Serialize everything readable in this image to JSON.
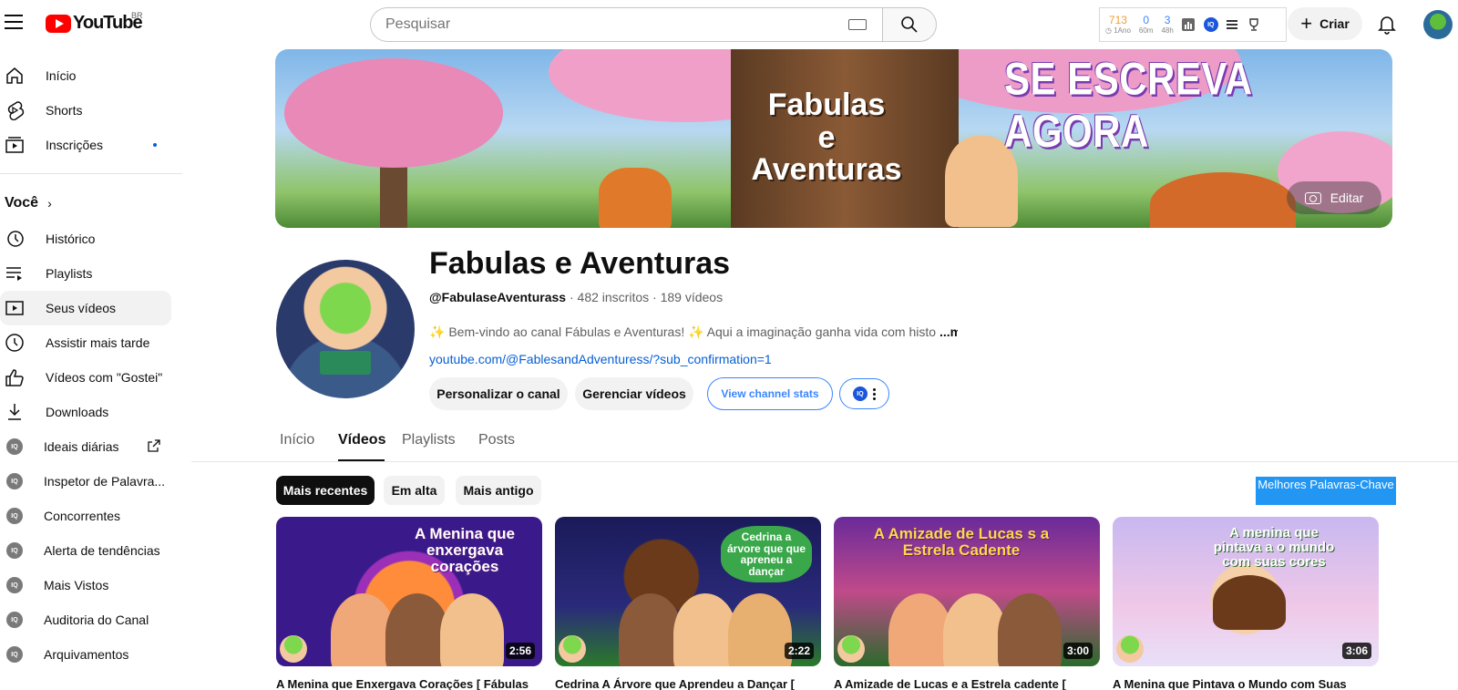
{
  "header": {
    "logo_text": "YouTube",
    "logo_country": "BR",
    "search_placeholder": "Pesquisar",
    "vidiq_stats": [
      {
        "value": "713",
        "label": "◷ 1Ano"
      },
      {
        "value": "0",
        "label": "60m"
      },
      {
        "value": "3",
        "label": "48h"
      }
    ],
    "create_label": "Criar",
    "colors": {
      "brand_red": "#ff0000",
      "vidiq_blue": "#3a86ff"
    }
  },
  "sidebar": {
    "main": [
      {
        "label": "Início",
        "icon": "home-icon"
      },
      {
        "label": "Shorts",
        "icon": "shorts-icon"
      },
      {
        "label": "Inscrições",
        "icon": "subscriptions-icon"
      }
    ],
    "you_label": "Você",
    "you_items": [
      {
        "label": "Histórico",
        "icon": "history-icon"
      },
      {
        "label": "Playlists",
        "icon": "playlists-icon"
      },
      {
        "label": "Seus vídeos",
        "icon": "your-videos-icon"
      },
      {
        "label": "Assistir mais tarde",
        "icon": "watch-later-icon"
      },
      {
        "label": "Vídeos com \"Gostei\"",
        "icon": "like-icon"
      },
      {
        "label": "Downloads",
        "icon": "download-icon"
      }
    ],
    "vidiq_items": [
      {
        "label": "Ideais diárias"
      },
      {
        "label": "Inspetor de Palavra..."
      },
      {
        "label": "Concorrentes"
      },
      {
        "label": "Alerta de tendências"
      },
      {
        "label": "Mais Vistos"
      },
      {
        "label": "Auditoria do Canal"
      },
      {
        "label": "Arquivamentos"
      }
    ]
  },
  "banner": {
    "headline": "SE ESCREVA AGORA",
    "logo_line1": "Fabulas",
    "logo_line2": "e Aventuras",
    "edit_label": "Editar"
  },
  "channel": {
    "name": "Fabulas e Aventuras",
    "handle": "@FabulaseAventurass",
    "subscribers": "482 inscritos",
    "video_count": "189 vídeos",
    "description": "✨ Bem-vindo ao canal Fábulas e Aventuras! ✨ Aqui a imaginação ganha vida com histo",
    "more_label": "...mais",
    "link": "youtube.com/@FablesandAdventuress/?sub_confirmation=1",
    "buttons": {
      "customize": "Personalizar o canal",
      "manage": "Gerenciar vídeos",
      "stats": "View channel stats"
    }
  },
  "tabs": [
    "Início",
    "Vídeos",
    "Playlists",
    "Posts"
  ],
  "chips": [
    "Mais recentes",
    "Em alta",
    "Mais antigo"
  ],
  "keywords_button": "Melhores Palavras-Chave",
  "videos": [
    {
      "title": "A Menina que Enxergava Corações [ Fábulas",
      "duration": "2:56",
      "thumb_text": "A Menina que enxergava corações"
    },
    {
      "title": "Cedrina A Árvore que Aprendeu a Dançar [",
      "duration": "2:22",
      "thumb_text": "Cedrina a árvore que que apreneu a dançar"
    },
    {
      "title": "A Amizade de Lucas e a Estrela cadente [",
      "duration": "3:00",
      "thumb_text": "A Amizade de Lucas s a Estrela Cadente"
    },
    {
      "title": "A Menina que Pintava o Mundo com Suas",
      "duration": "3:06",
      "thumb_text": "A menina que pintava a o mundo com suas cores"
    }
  ]
}
